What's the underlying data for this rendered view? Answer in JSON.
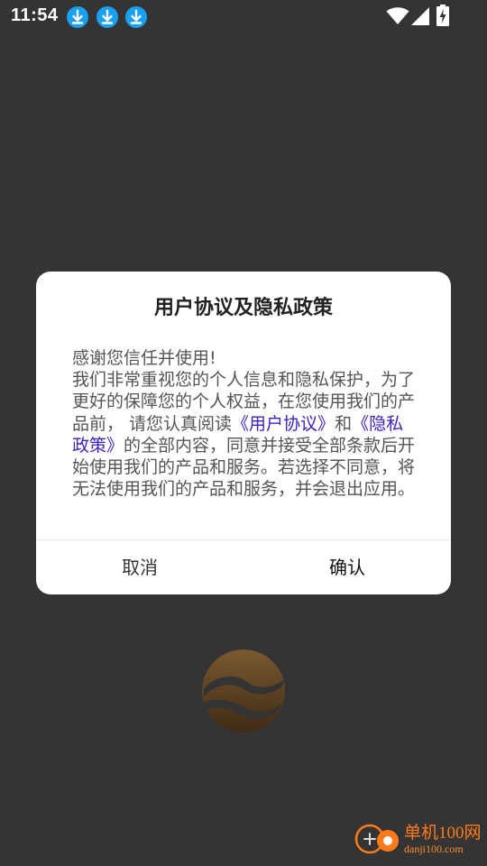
{
  "status_bar": {
    "time": "11:54",
    "notification_icons": [
      "download-icon",
      "download-icon",
      "download-icon"
    ],
    "system_icons": [
      "wifi-icon",
      "cellular-signal-icon",
      "battery-charging-icon"
    ]
  },
  "dialog": {
    "title": "用户协议及隐私政策",
    "body": {
      "line1": "感谢您信任并使用!",
      "part1": "我们非常重视您的个人信息和隐私保护，为了更好的保障您的个人权益，在您使用我们的产品前， 请您认真阅读",
      "link_user_agreement": "《用户协议》",
      "part2": "和",
      "link_privacy_policy": "《隐私政策》",
      "part3": "的全部内容，同意并接受全部条款后开始使用我们的产品和服务。若选择不同意，将无法使用我们的产品和服务，并会退出应用。"
    },
    "cancel_label": "取消",
    "confirm_label": "确认"
  },
  "watermark": {
    "brand": "单机100网",
    "domain": "danji100.com"
  },
  "colors": {
    "background": "#343434",
    "dialog_bg": "#ffffff",
    "link": "#3a22c8",
    "status_download": "#1aa0f0",
    "watermark": "#ff7a1a"
  }
}
